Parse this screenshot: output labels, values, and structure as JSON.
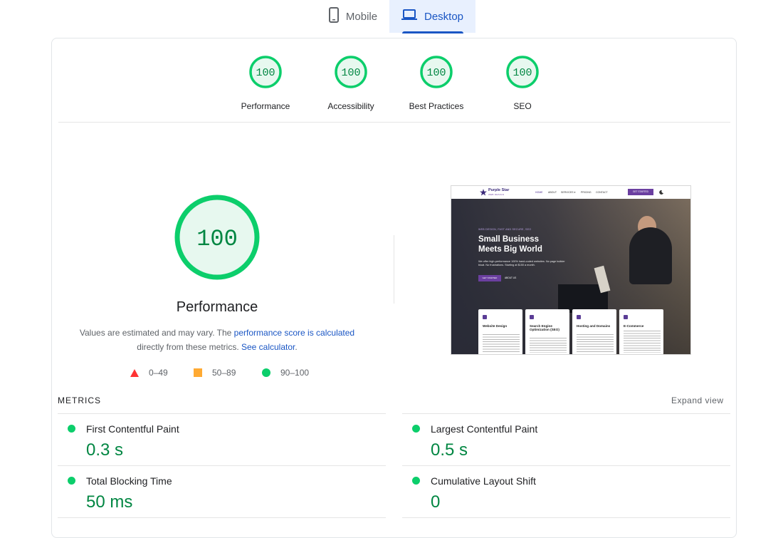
{
  "tabs": [
    {
      "label": "Mobile",
      "icon": "phone-icon",
      "selected": false
    },
    {
      "label": "Desktop",
      "icon": "laptop-icon",
      "selected": true
    }
  ],
  "categories": [
    {
      "score": "100",
      "label": "Performance"
    },
    {
      "score": "100",
      "label": "Accessibility"
    },
    {
      "score": "100",
      "label": "Best Practices"
    },
    {
      "score": "100",
      "label": "SEO"
    }
  ],
  "performance": {
    "score": "100",
    "title": "Performance",
    "desc_part1": "Values are estimated and may vary. The ",
    "desc_link1": "performance score is calculated",
    "desc_part2": "directly from these metrics. ",
    "desc_link2": "See calculator",
    "desc_part3": "."
  },
  "legend": [
    {
      "range": "0–49",
      "color": "#ff3333"
    },
    {
      "range": "50–89",
      "color": "#ffaa33"
    },
    {
      "range": "90–100",
      "color": "#0cce6b"
    }
  ],
  "screenshot": {
    "brand": "Purple Star",
    "brand_sub": "WEB DESIGN",
    "nav": [
      "HOME",
      "ABOUT",
      "SERVICES ▾",
      "PRICING",
      "CONTACT"
    ],
    "nav_cta": "GET STARTED",
    "eyebrow": "WEB DESIGN, FAST AND SECURE, SEO",
    "headline_1": "Small Business",
    "headline_2": "Meets Big World",
    "subtext": "We offer high-performance 100% hand-coded websites. No page builder bloat. No frustrations. Starting at $150 a month.",
    "btn_primary": "GET STARTED",
    "btn_secondary": "ABOUT US",
    "cards": [
      "Website Design",
      "Search Engine Optimization (SEO)",
      "Hosting and Domains",
      "E-Commerce"
    ]
  },
  "metrics": {
    "title": "METRICS",
    "expand": "Expand view",
    "items": [
      {
        "name": "First Contentful Paint",
        "value": "0.3 s"
      },
      {
        "name": "Largest Contentful Paint",
        "value": "0.5 s"
      },
      {
        "name": "Total Blocking Time",
        "value": "50 ms"
      },
      {
        "name": "Cumulative Layout Shift",
        "value": "0"
      }
    ]
  },
  "colors": {
    "pass": "#0cce6b",
    "pass_text": "#018642",
    "pass_fill": "#e7f8ef",
    "accent": "#1a56c4",
    "tab_selected_bg": "#e8f0fe"
  }
}
